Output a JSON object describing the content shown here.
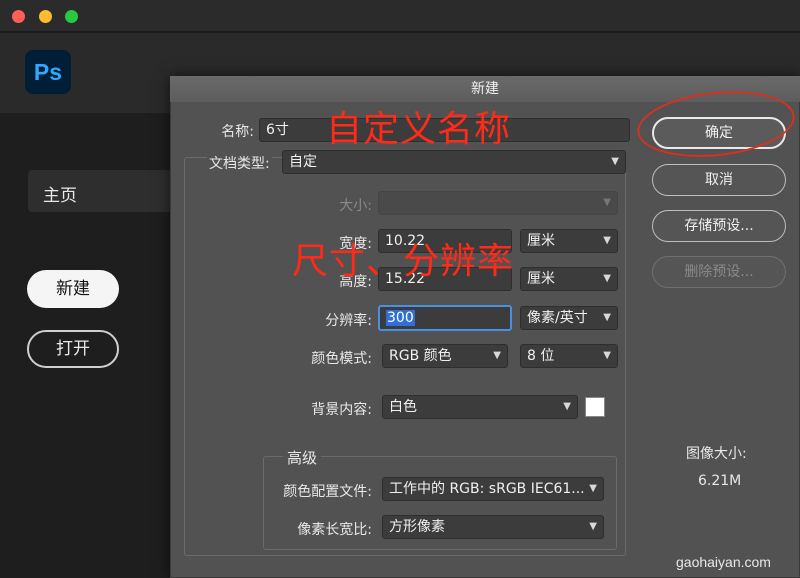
{
  "app": {
    "logo_text": "Ps",
    "sidebar": {
      "home_label": "主页"
    },
    "new_button": "新建",
    "open_button": "打开"
  },
  "dialog": {
    "title": "新建",
    "name_label": "名称:",
    "name_value": "6寸",
    "doc_type_label": "文档类型:",
    "doc_type_value": "自定",
    "size_label": "大小:",
    "size_value": "",
    "width_label": "宽度:",
    "width_value": "10.22",
    "width_unit": "厘米",
    "height_label": "高度:",
    "height_value": "15.22",
    "height_unit": "厘米",
    "resolution_label": "分辨率:",
    "resolution_value": "300",
    "resolution_unit": "像素/英寸",
    "color_mode_label": "颜色模式:",
    "color_mode_value": "RGB 颜色",
    "bit_depth": "8 位",
    "background_label": "背景内容:",
    "background_value": "白色",
    "background_swatch": "#ffffff",
    "advanced_label": "高级",
    "color_profile_label": "颜色配置文件:",
    "color_profile_value": "工作中的 RGB: sRGB IEC61...",
    "pixel_aspect_label": "像素长宽比:",
    "pixel_aspect_value": "方形像素",
    "buttons": {
      "ok": "确定",
      "cancel": "取消",
      "save_preset": "存储预设...",
      "delete_preset": "删除预设..."
    },
    "image_size_label": "图像大小:",
    "image_size_value": "6.21M"
  },
  "annotations": {
    "custom_name": "自定义名称",
    "size_resolution": "尺寸、分辨率"
  },
  "watermark": "gaohaiyan.com",
  "colors": {
    "annotation_red": "#ff2a17",
    "ps_blue": "#31a8ff",
    "ps_bg": "#001e36"
  }
}
